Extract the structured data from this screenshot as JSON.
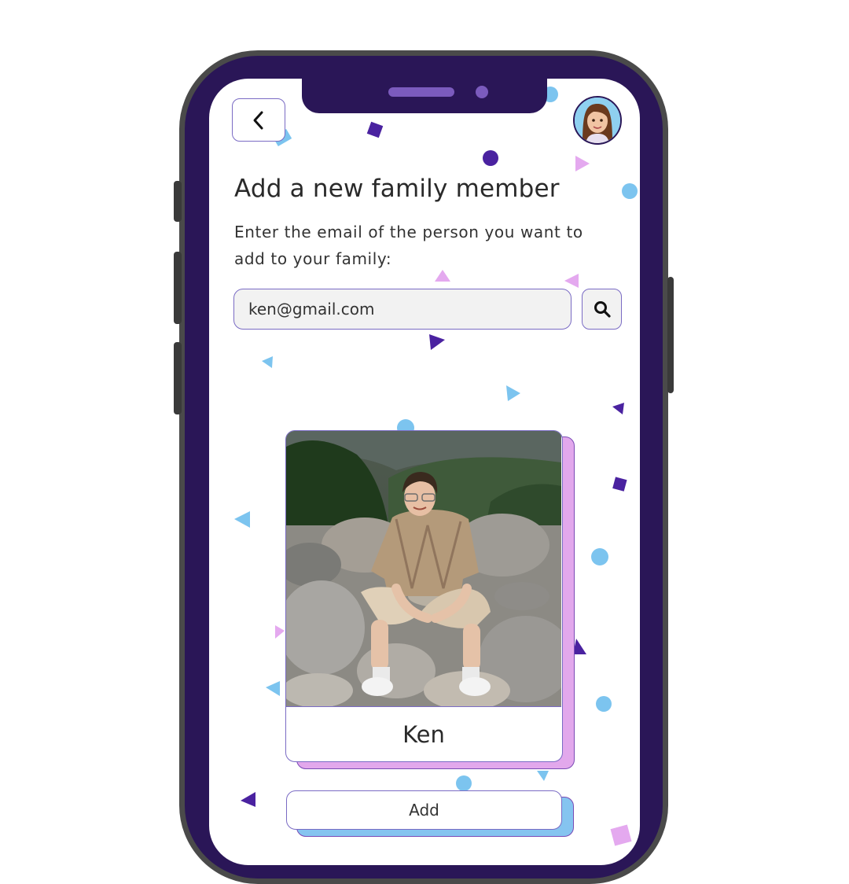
{
  "header": {
    "back_icon": "chevron-left-icon",
    "avatar_icon": "user-avatar"
  },
  "page": {
    "title": "Add a new family member",
    "subtitle": "Enter the email of the person you want to add to your family:"
  },
  "search": {
    "value": "ken@gmail.com",
    "icon": "search-icon"
  },
  "result_card": {
    "name": "Ken"
  },
  "actions": {
    "add_label": "Add"
  },
  "colors": {
    "frame": "#2a1657",
    "accent_border": "#7a6bc4",
    "card_shadow": "#e2a8ec",
    "button_shadow": "#85c4f0",
    "confetti_purple": "#4a22a0",
    "confetti_blue": "#7cc4ef",
    "confetti_pink": "#e4a9ef"
  }
}
